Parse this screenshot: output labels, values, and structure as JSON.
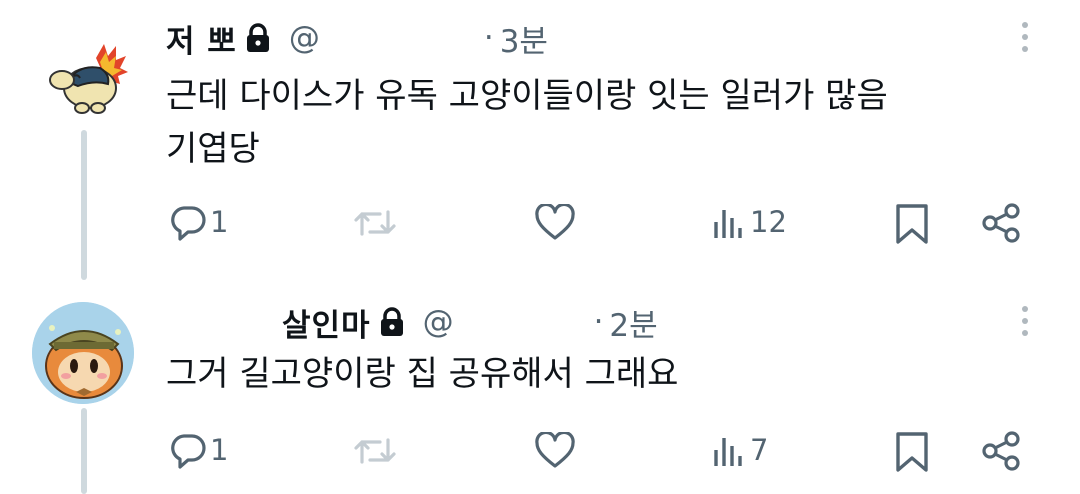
{
  "tweets": [
    {
      "name": "저   뽀",
      "handle": "@",
      "dot": "·",
      "time": "3분",
      "text": "근데 다이스가 유독 고양이들이랑 잇는 일러가 많음\n기엽당",
      "replies": "1",
      "retweets": "",
      "views": "12",
      "avatar_icon": "cyndaquil-avatar",
      "lock_icon": "lock-icon"
    },
    {
      "name": "살인마",
      "handle": "@",
      "dot": "·",
      "time": "2분",
      "text": "그거 길고양이랑 집 공유해서 그래요",
      "replies": "1",
      "retweets": "",
      "views": "7",
      "avatar_icon": "waddle-dee-avatar",
      "lock_icon": "lock-icon"
    }
  ],
  "colors": {
    "text": "#0f1419",
    "muted": "#536471",
    "thread_line": "#cfd9de",
    "background": "#ffffff"
  }
}
